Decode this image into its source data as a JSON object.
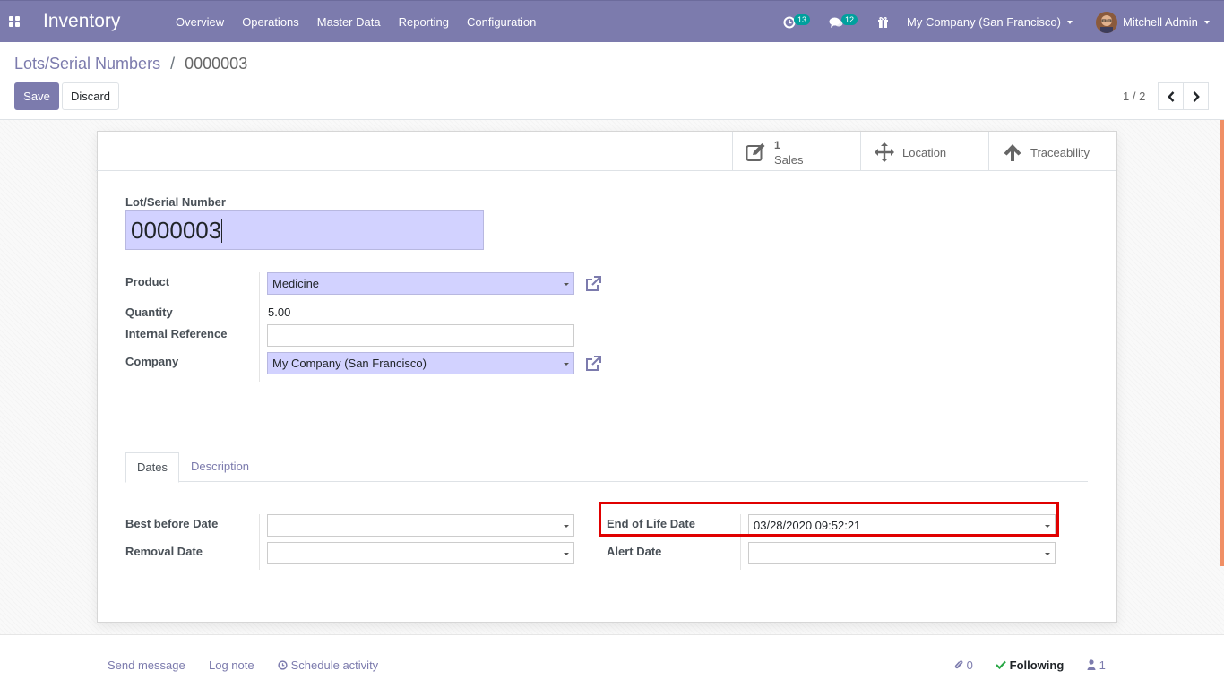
{
  "navbar": {
    "app_name": "Inventory",
    "menu": [
      "Overview",
      "Operations",
      "Master Data",
      "Reporting",
      "Configuration"
    ],
    "activity_count": "13",
    "message_count": "12",
    "company": "My Company (San Francisco)",
    "user": "Mitchell Admin"
  },
  "breadcrumb": {
    "parent": "Lots/Serial Numbers",
    "separator": "/",
    "current": "0000003"
  },
  "actions": {
    "save_label": "Save",
    "discard_label": "Discard"
  },
  "pager": {
    "value": "1 / 2"
  },
  "smart_buttons": {
    "sales_count": "1",
    "sales_label": "Sales",
    "location_label": "Location",
    "traceability_label": "Traceability"
  },
  "form": {
    "name_label": "Lot/Serial Number",
    "name_value": "0000003",
    "product_label": "Product",
    "product_value": "Medicine",
    "quantity_label": "Quantity",
    "quantity_value": "5.00",
    "ref_label": "Internal Reference",
    "ref_value": "",
    "company_label": "Company",
    "company_value": "My Company (San Francisco)"
  },
  "tabs": {
    "dates": "Dates",
    "description": "Description"
  },
  "dates": {
    "best_before_label": "Best before Date",
    "best_before_value": "",
    "removal_label": "Removal Date",
    "removal_value": "",
    "end_of_life_label": "End of Life Date",
    "end_of_life_value": "03/28/2020 09:52:21",
    "alert_label": "Alert Date",
    "alert_value": ""
  },
  "chatter": {
    "send_message": "Send message",
    "log_note": "Log note",
    "schedule_activity": "Schedule activity",
    "attachments": "0",
    "following": "Following",
    "followers": "1"
  },
  "colors": {
    "brand": "#7c7bad",
    "required_field": "#d2d2ff",
    "highlight": "#e00000",
    "badge": "#00a09d"
  }
}
